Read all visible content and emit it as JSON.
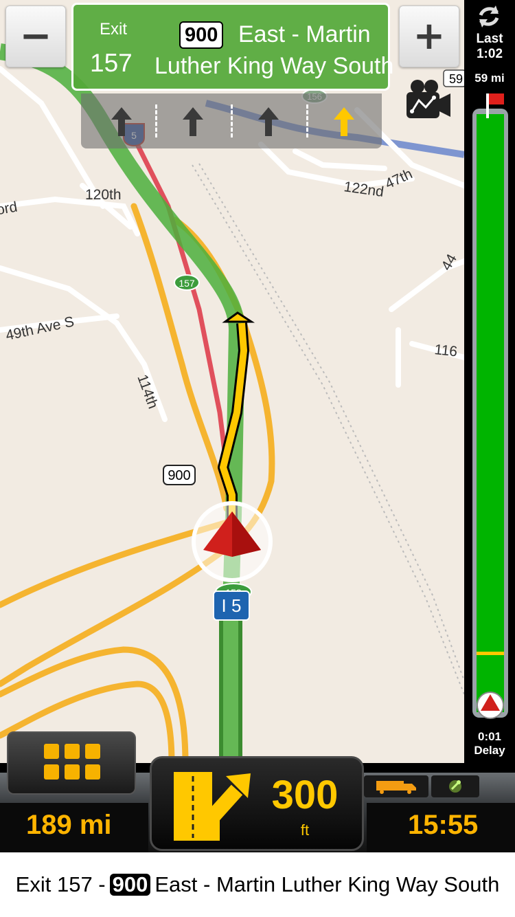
{
  "map": {
    "labels": {
      "street_120th": "120th",
      "street_ord": "ord",
      "street_122nd": "122nd",
      "street_47th": "47th",
      "street_44": "44",
      "street_49th_ave": "49th Ave S",
      "street_114th": "114th",
      "street_116": "116",
      "route_900": "900",
      "exit_157": "157",
      "exit_156": "156",
      "interstate_shield_small": "5",
      "route_59_partial": "59",
      "interstate_label": "I 5",
      "exit_158_partial": "158"
    }
  },
  "controls": {
    "zoom_out": "−",
    "zoom_in": "+"
  },
  "exit_sign": {
    "label": "Exit",
    "number": "157",
    "route": "900",
    "dest_line1": "East - Martin",
    "dest_line2": "Luther King Way South"
  },
  "right_panel": {
    "last_label": "Last",
    "last_value": "1:02",
    "total_distance": "59 mi",
    "progress_fraction": 0.99,
    "delay_value": "0:01",
    "delay_label": "Delay"
  },
  "dashboard": {
    "remaining_distance": "189 mi",
    "next_distance": "300",
    "next_unit": "ft",
    "clock": "15:55"
  },
  "instruction": {
    "exit_text": "Exit 157 -",
    "route": "900",
    "dest_text": "East - Martin Luther King Way South"
  },
  "colors": {
    "route_green": "#4caf3c",
    "nav_yellow": "#ffc800",
    "dashboard_orange": "#ffb400",
    "progress_green": "#00b400",
    "marker_red": "#d0201c",
    "map_bg": "#f2ebe2",
    "road_orange": "#f5b430"
  },
  "icons": {
    "sync": "sync-icon",
    "camera": "route-camera-icon",
    "flag": "destination-flag-icon",
    "menu": "grid-menu-icon",
    "truck": "truck-icon",
    "gps": "gps-satellite-icon",
    "turn": "keep-right-turn-icon"
  }
}
